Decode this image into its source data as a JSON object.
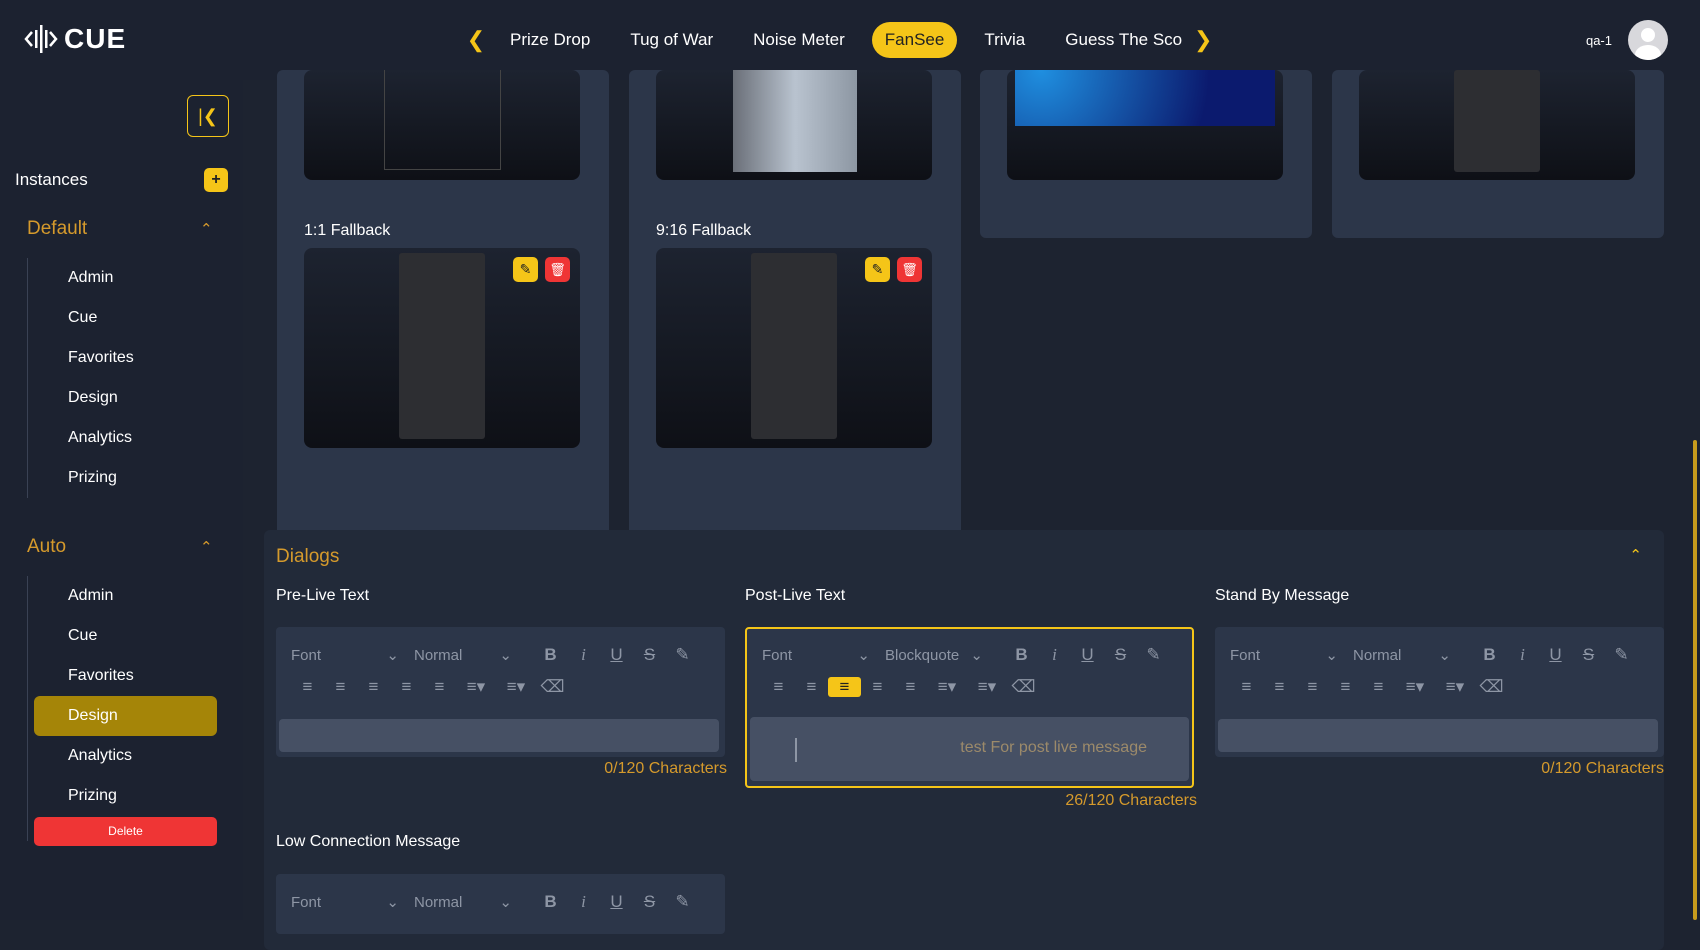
{
  "app": {
    "logo": "CUE"
  },
  "nav": {
    "tabs": [
      {
        "label": "Prize Drop"
      },
      {
        "label": "Tug of War"
      },
      {
        "label": "Noise Meter"
      },
      {
        "label": "FanSee"
      },
      {
        "label": "Trivia"
      },
      {
        "label": "Guess The Score"
      }
    ],
    "active_tab": "FanSee"
  },
  "user": {
    "name": "qa-1"
  },
  "sidebar": {
    "instances_label": "Instances",
    "add_label": "+",
    "groups": [
      {
        "title": "Default",
        "items": [
          "Admin",
          "Cue",
          "Favorites",
          "Design",
          "Analytics",
          "Prizing"
        ]
      },
      {
        "title": "Auto",
        "items": [
          "Admin",
          "Cue",
          "Favorites",
          "Design",
          "Analytics",
          "Prizing"
        ],
        "active_item": "Design"
      }
    ],
    "delete_label": "Delete"
  },
  "fallbacks": {
    "one_one": "1:1 Fallback",
    "nine_sixteen": "9:16 Fallback"
  },
  "dialogs": {
    "title": "Dialogs",
    "pre_live": {
      "label": "Pre-Live Text",
      "font": "Font",
      "size": "Normal",
      "value": "",
      "counter": "0/120 Characters"
    },
    "post_live": {
      "label": "Post-Live Text",
      "font": "Font",
      "size": "Blockquote",
      "value": "test For post live message",
      "counter": "26/120 Characters"
    },
    "stand_by": {
      "label": "Stand By Message",
      "font": "Font",
      "size": "Normal",
      "value": "",
      "counter": "0/120 Characters"
    },
    "low_connection": {
      "label": "Low Connection Message",
      "font": "Font",
      "size": "Normal"
    }
  },
  "colors": {
    "accent": "#f5c518",
    "accent_text": "#d59a2c",
    "danger": "#ef3535",
    "panel": "#2c3649",
    "bg": "#1d2330"
  }
}
